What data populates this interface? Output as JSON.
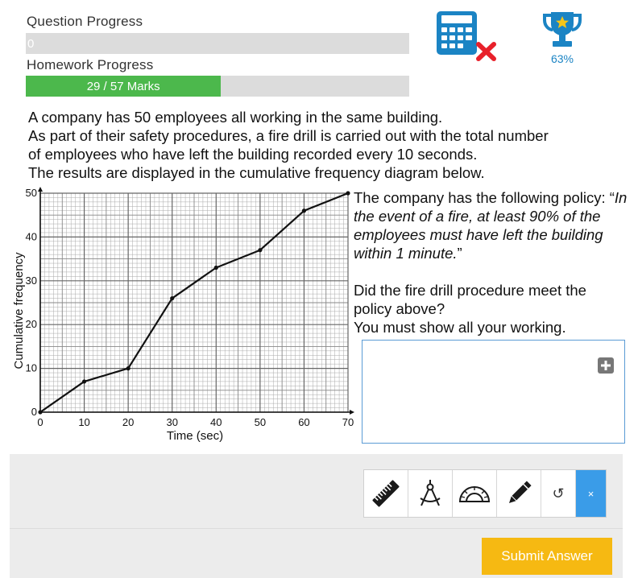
{
  "progress": {
    "question_label": "Question Progress",
    "question_value_text": "0",
    "question_fraction": 0,
    "homework_label": "Homework Progress",
    "homework_value_text": "29 / 57 Marks",
    "homework_fraction": 0.509
  },
  "status": {
    "calculator_icon": "calculator-not-allowed-icon",
    "trophy_icon": "trophy-icon",
    "score_percent": "63%"
  },
  "question": {
    "intro_lines": [
      "A company has 50 employees all working in the same building.",
      "As part of their safety procedures, a fire drill is carried out with the total number",
      "of employees who have left the building recorded every 10 seconds.",
      "The results are displayed in the cumulative frequency diagram below."
    ],
    "policy_lead": "The company has the following policy: “",
    "policy_quote": "In the event of a fire, at least 90% of the employees must have left the building within 1 minute.",
    "policy_close": "”",
    "prompt": "Did the fire drill procedure meet the policy above?",
    "instruction": "You must show all your working."
  },
  "answer": {
    "value": "",
    "add_icon": "plus-icon"
  },
  "toolbar": {
    "tools": [
      "ruler-icon",
      "compass-icon",
      "protractor-icon",
      "pencil-icon"
    ],
    "undo_icon": "undo-icon",
    "undo_symbol": "↺",
    "close_symbol": "×"
  },
  "submit": {
    "label": "Submit Answer"
  },
  "colors": {
    "accent_green": "#4cb84c",
    "accent_blue": "#3a9ce8",
    "submit_yellow": "#f6b912",
    "calculator_blue": "#1b84c4",
    "cross_red": "#e8202a",
    "trophy_blue": "#1b84c4",
    "trophy_star": "#f5c518"
  },
  "chart_data": {
    "type": "line",
    "title": "",
    "xlabel": "Time (sec)",
    "ylabel": "Cumulative frequency",
    "xlim": [
      0,
      70
    ],
    "ylim": [
      0,
      50
    ],
    "x_ticks": [
      0,
      10,
      20,
      30,
      40,
      50,
      60,
      70
    ],
    "y_ticks": [
      0,
      10,
      20,
      30,
      40,
      50
    ],
    "grid": true,
    "series": [
      {
        "x": [
          0,
          10,
          20,
          30,
          40,
          50,
          60,
          70
        ],
        "y": [
          0,
          7,
          10,
          26,
          33,
          37,
          46,
          50
        ]
      }
    ]
  }
}
